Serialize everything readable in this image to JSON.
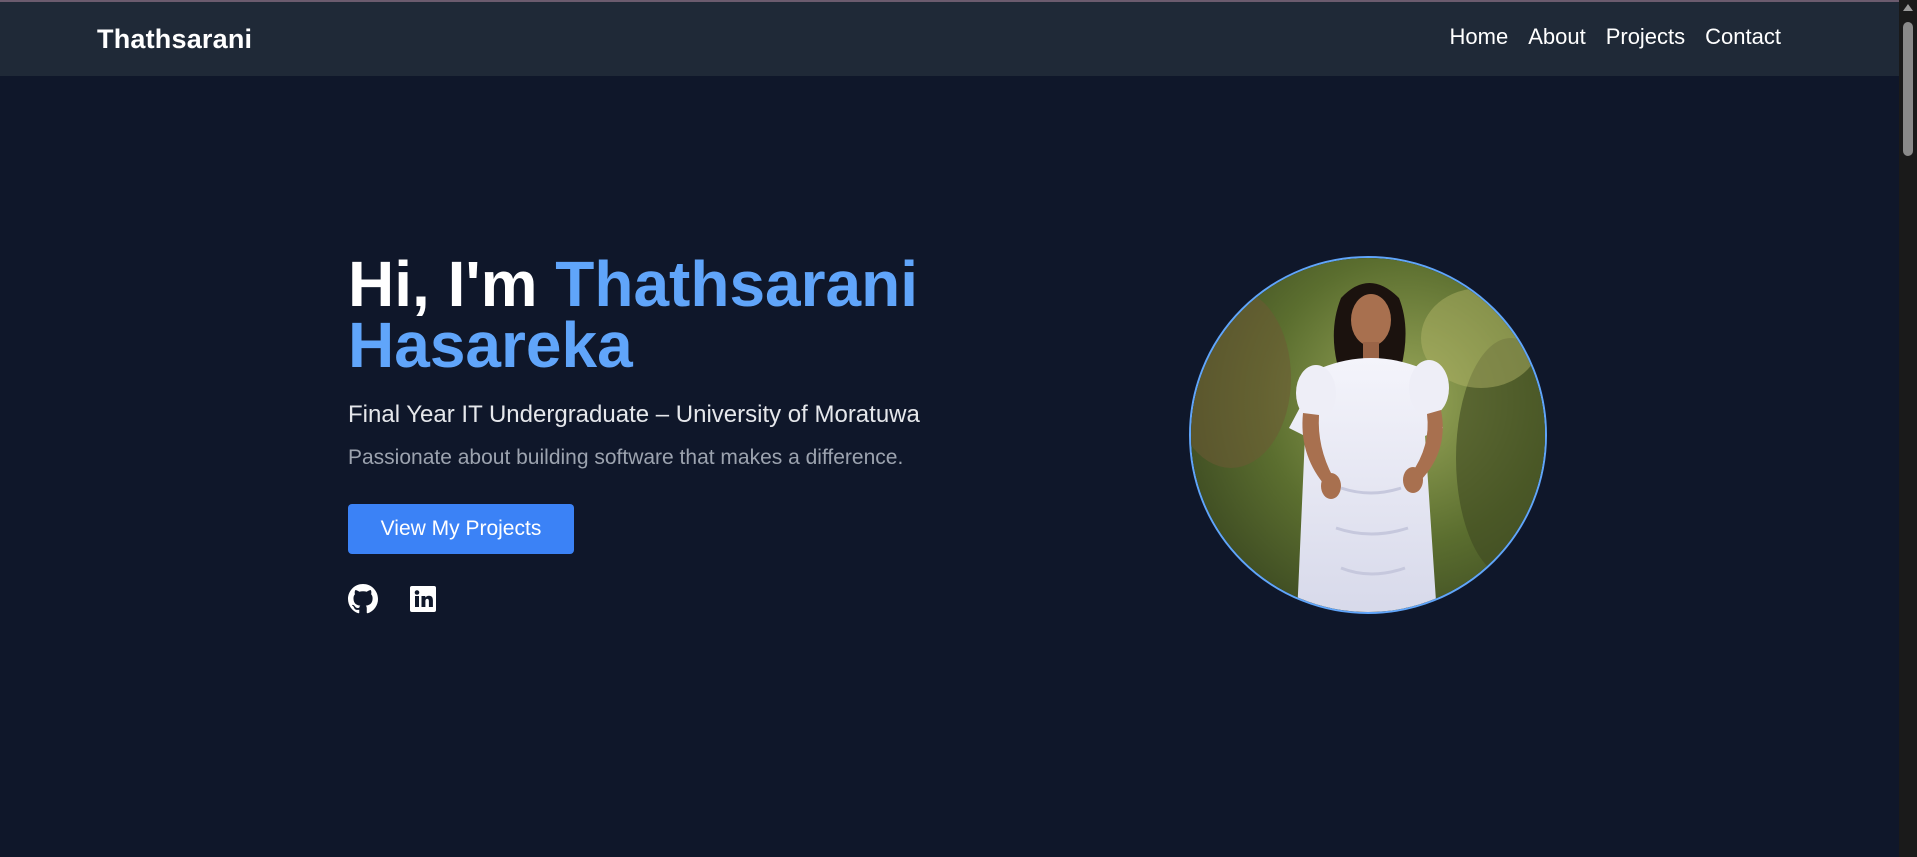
{
  "navbar": {
    "brand": "Thathsarani",
    "links": [
      {
        "label": "Home"
      },
      {
        "label": "About"
      },
      {
        "label": "Projects"
      },
      {
        "label": "Contact"
      }
    ]
  },
  "hero": {
    "greeting": "Hi, I'm",
    "name_first": "Thathsarani",
    "name_last": "Hasareka",
    "subtitle": "Final Year IT Undergraduate – University of Moratuwa",
    "tagline": "Passionate about building software that makes a difference.",
    "cta_label": "View My Projects",
    "socials": [
      {
        "icon": "github-icon"
      },
      {
        "icon": "linkedin-icon"
      }
    ]
  },
  "colors": {
    "background": "#0f172a",
    "navbar": "#1f2937",
    "accent": "#60a5fa",
    "button": "#3b82f6",
    "muted_text": "#9ca3af"
  }
}
